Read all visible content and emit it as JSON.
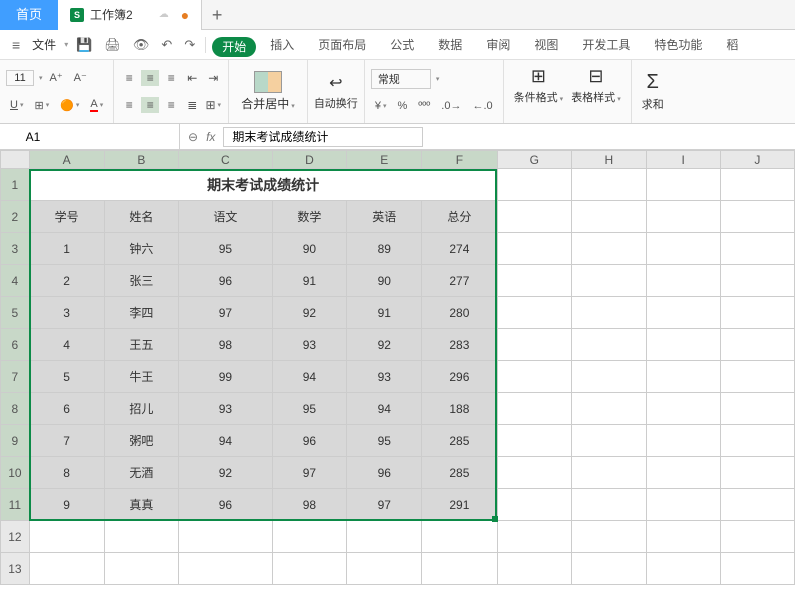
{
  "tabs": {
    "home": "首页",
    "doc": "工作簿2",
    "doc_icon": "S"
  },
  "menus": {
    "file": "文件",
    "items": [
      "开始",
      "插入",
      "页面布局",
      "公式",
      "数据",
      "审阅",
      "视图",
      "开发工具",
      "特色功能",
      "稻"
    ]
  },
  "ribbon": {
    "font_size": "11",
    "merge": "合并居中",
    "wrap": "自动换行",
    "number_format": "常规",
    "cond_fmt": "条件格式",
    "table_fmt": "表格样式",
    "sum": "求和"
  },
  "formula": {
    "cell_ref": "A1",
    "fx": "fx",
    "value": "期末考试成绩统计"
  },
  "columns": [
    "A",
    "B",
    "C",
    "D",
    "E",
    "F",
    "G",
    "H",
    "I",
    "J"
  ],
  "row_numbers": [
    1,
    2,
    3,
    4,
    5,
    6,
    7,
    8,
    9,
    10,
    11,
    12,
    13
  ],
  "chart_data": {
    "type": "table",
    "title": "期末考试成绩统计",
    "headers": [
      "学号",
      "姓名",
      "语文",
      "数学",
      "英语",
      "总分"
    ],
    "rows": [
      [
        "1",
        "钟六",
        "95",
        "90",
        "89",
        "274"
      ],
      [
        "2",
        "张三",
        "96",
        "91",
        "90",
        "277"
      ],
      [
        "3",
        "李四",
        "97",
        "92",
        "91",
        "280"
      ],
      [
        "4",
        "王五",
        "98",
        "93",
        "92",
        "283"
      ],
      [
        "5",
        "牛王",
        "99",
        "94",
        "93",
        "296"
      ],
      [
        "6",
        "招儿",
        "93",
        "95",
        "94",
        "188"
      ],
      [
        "7",
        "粥吧",
        "94",
        "96",
        "95",
        "285"
      ],
      [
        "8",
        "无酒",
        "92",
        "97",
        "96",
        "285"
      ],
      [
        "9",
        "真真",
        "96",
        "98",
        "97",
        "291"
      ]
    ]
  }
}
